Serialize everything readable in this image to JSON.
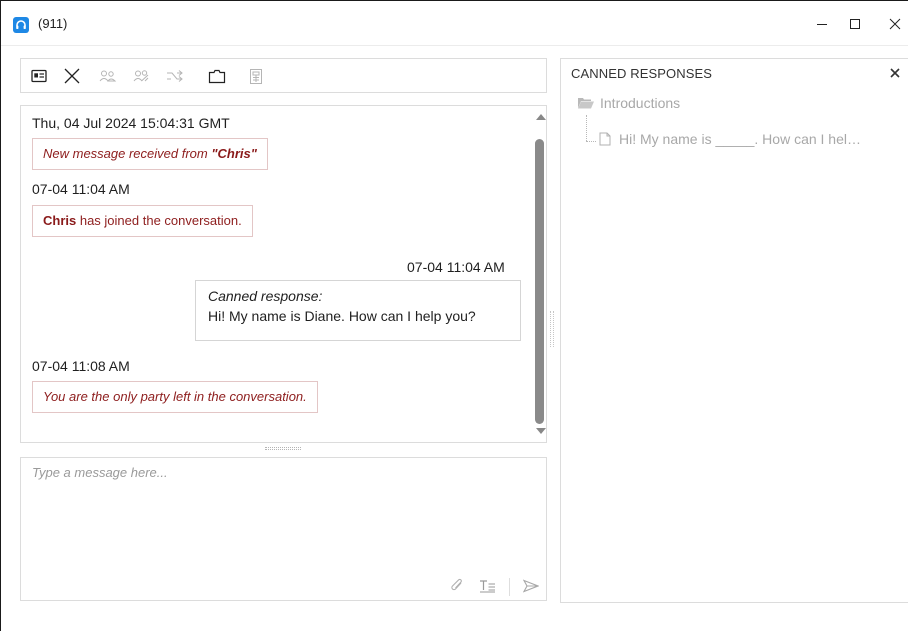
{
  "window": {
    "title": "(911)",
    "accent_color": "#1e88e5",
    "controls": {
      "minimize": "minimize-icon",
      "maximize": "maximize-icon",
      "close": "close-icon"
    }
  },
  "toolbar": {
    "icons": [
      "contact-card-icon",
      "end-chat-icon",
      "consult-icon",
      "conference-icon",
      "transfer-icon",
      "folder-icon",
      "case-icon"
    ]
  },
  "chat": {
    "start_timestamp": "Thu, 04 Jul 2024 15:04:31 GMT",
    "new_message_prefix": "New message received from ",
    "new_message_sender": "\"Chris\"",
    "joined_time": "07-04 11:04 AM",
    "joined_name": "Chris",
    "joined_suffix": " has joined the conversation.",
    "agent_time": "07-04 11:04 AM",
    "agent_label": "Canned response:",
    "agent_text": "Hi! My name is Diane. How can I help you?",
    "left_time": "07-04 11:08 AM",
    "left_text": "You are the only party left in the conversation.",
    "system_text_color": "#8f2020"
  },
  "composer": {
    "placeholder": "Type a message here...",
    "value": "",
    "icons": [
      "attach-icon",
      "format-text-icon",
      "send-icon"
    ]
  },
  "canned": {
    "title": "CANNED RESPONSES",
    "folder": "Introductions",
    "item": "Hi! My name is _____. How can I hel…"
  }
}
